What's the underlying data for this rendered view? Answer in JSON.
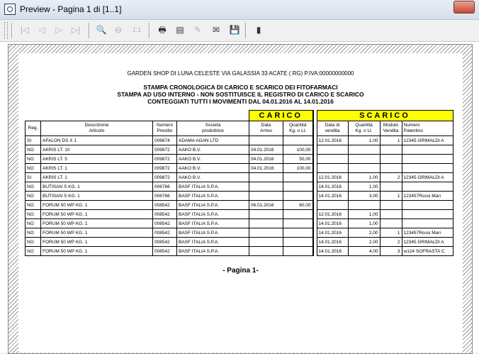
{
  "window": {
    "title": "Preview - Pagina 1 di [1..1]"
  },
  "toolbar": {
    "icons": [
      "grip-icon",
      "first-page-icon",
      "prev-page-icon",
      "next-page-icon",
      "last-page-icon",
      "zoom-in-icon",
      "zoom-out-icon",
      "one-to-one-icon",
      "print-icon",
      "print-setup-icon",
      "export-icon",
      "email-icon",
      "save-icon",
      "close-preview-icon"
    ]
  },
  "report": {
    "company": "GARDEN SHOP DI LUNA CELESTE VIA GALASSIA 33 ACATE ( RG) P.IVA:00000000000",
    "title1": "STAMPA CRONOLOGICA DI CARICO E SCARICO DEI FITOFARMACI",
    "title2": "STAMPA AD USO INTERNO - NON SOSTITUISCE IL REGISTRO DI CARICO E SCARICO",
    "title3": "CONTEGGIATI TUTTI I MOVIMENTI DAL 04.01.2016 AL 14.01.2016",
    "carico_label": "CARICO",
    "scarico_label": "SCARICO",
    "headers": {
      "reg": "Reg.",
      "descr1": "Descrizione",
      "descr2": "Articolo",
      "num1": "Numero",
      "num2": "Prestito",
      "soc1": "Società",
      "soc2": "produttrice",
      "darr1": "Data",
      "darr2": "Arrivo",
      "qc1": "Quantità",
      "qc2": "Kg. o Lt.",
      "dven1": "Data di",
      "dven2": "vendita",
      "qs1": "Quantità",
      "qs2": "Kg. o Lt.",
      "mod1": "Modulo",
      "mod2": "Vendita",
      "pat1": "Numero",
      "pat2": "Patentino"
    },
    "rows": [
      {
        "reg": "SI",
        "descr": "AFALON DS X 1",
        "num": "006674",
        "soc": "ADAMA AGAN LTD",
        "darr": "",
        "qc": "",
        "dven": "12.01.2016",
        "qs": "1,00",
        "mod": "1",
        "pat": "12345 GRIMALDI A"
      },
      {
        "reg": "NO",
        "descr": "AKRIS LT. 10",
        "num": "009872",
        "soc": "AAKO B.V.",
        "darr": "04.01.2016",
        "qc": "100,00",
        "dven": "",
        "qs": "",
        "mod": "",
        "pat": ""
      },
      {
        "reg": "NO",
        "descr": "AKRIS LT. 5",
        "num": "009872",
        "soc": "AAKO B.V.",
        "darr": "04.01.2016",
        "qc": "50,00",
        "dven": "",
        "qs": "",
        "mod": "",
        "pat": ""
      },
      {
        "reg": "NO",
        "descr": "AKRIS LT. 1",
        "num": "009872",
        "soc": "AAKO B.V.",
        "darr": "04.01.2016",
        "qc": "100,00",
        "dven": "",
        "qs": "",
        "mod": "",
        "pat": ""
      },
      {
        "reg": "SI",
        "descr": "AKRIS LT. 1",
        "num": "009872",
        "soc": "AAKO B.V.",
        "darr": "",
        "qc": "",
        "dven": "12.01.2016",
        "qs": "1,00",
        "mod": "2",
        "pat": "12345 GRIMALDI A"
      },
      {
        "reg": "NO",
        "descr": "BUTISAN S KG. 1",
        "num": "006766",
        "soc": "BASF ITALIA S.P.A.",
        "darr": "",
        "qc": "",
        "dven": "14.01.2016",
        "qs": "1,00",
        "mod": "",
        "pat": ""
      },
      {
        "reg": "NO",
        "descr": "BUTISAN S KG. 1",
        "num": "006766",
        "soc": "BASF ITALIA S.P.A.",
        "darr": "",
        "qc": "",
        "dven": "14.01.2016",
        "qs": "3,00",
        "mod": "1",
        "pat": "123457Rossi Mari"
      },
      {
        "reg": "NO",
        "descr": "FORUM 50 WP KG. 1",
        "num": "008542",
        "soc": "BASF ITALIA S.P.A.",
        "darr": "06.01.2016",
        "qc": "60,00",
        "dven": "",
        "qs": "",
        "mod": "",
        "pat": ""
      },
      {
        "reg": "NO",
        "descr": "FORUM 50 WP KG. 1",
        "num": "008542",
        "soc": "BASF ITALIA S.P.A.",
        "darr": "",
        "qc": "",
        "dven": "12.01.2016",
        "qs": "1,00",
        "mod": "",
        "pat": ""
      },
      {
        "reg": "NO",
        "descr": "FORUM 50 WP KG. 1",
        "num": "008542",
        "soc": "BASF ITALIA S.P.A.",
        "darr": "",
        "qc": "",
        "dven": "14.01.2016",
        "qs": "1,00",
        "mod": "",
        "pat": ""
      },
      {
        "reg": "NO",
        "descr": "FORUM 50 WP KG. 1",
        "num": "008542",
        "soc": "BASF ITALIA S.P.A.",
        "darr": "",
        "qc": "",
        "dven": "14.01.2016",
        "qs": "2,00",
        "mod": "1",
        "pat": "123457Rossi Mari"
      },
      {
        "reg": "NO",
        "descr": "FORUM 50 WP KG. 1",
        "num": "008542",
        "soc": "BASF ITALIA S.P.A.",
        "darr": "",
        "qc": "",
        "dven": "14.01.2016",
        "qs": "2,00",
        "mod": "2",
        "pat": "12345 GRIMALDI A"
      },
      {
        "reg": "NO",
        "descr": "FORUM 50 WP KG. 1",
        "num": "008542",
        "soc": "BASF ITALIA S.P.A.",
        "darr": "",
        "qc": "",
        "dven": "14.01.2016",
        "qs": "4,00",
        "mod": "3",
        "pat": "w124 SOFRASTA C"
      }
    ],
    "footer": "- Pagina 1-"
  }
}
